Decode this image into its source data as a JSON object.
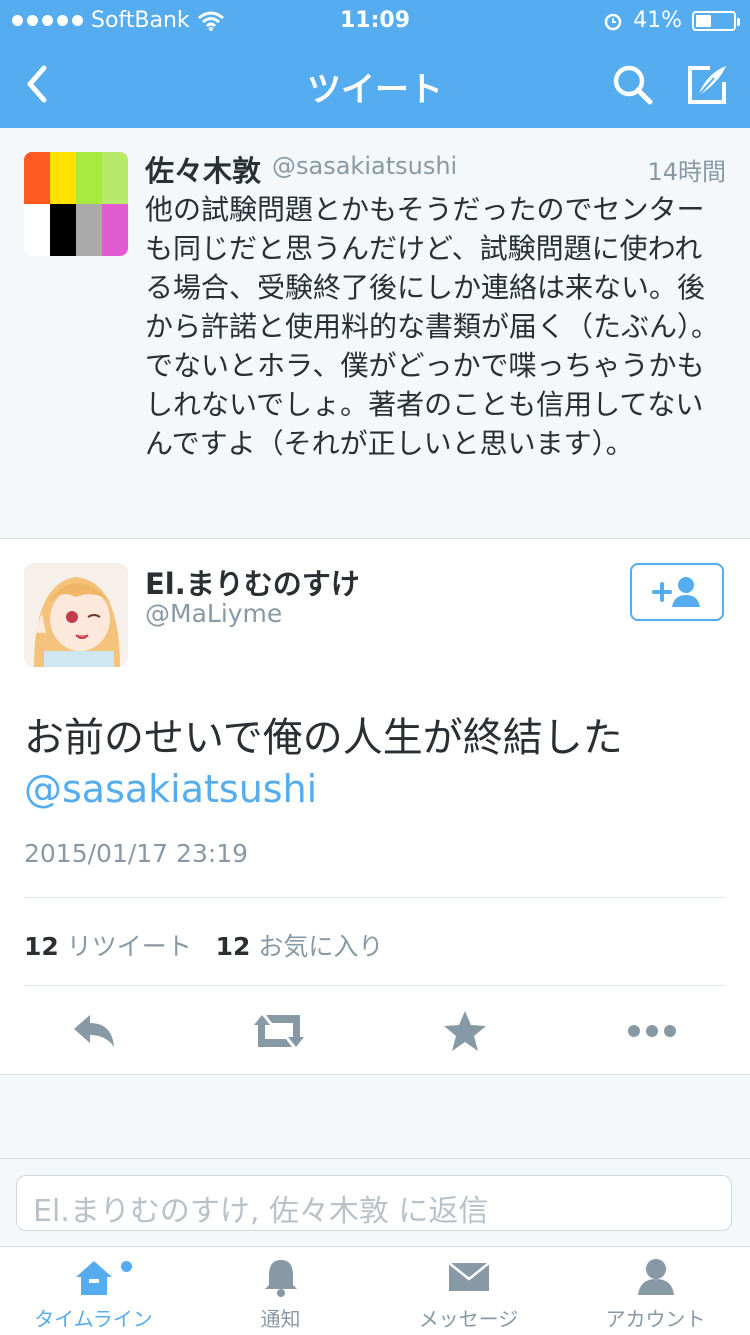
{
  "status": {
    "carrier": "SoftBank",
    "time": "11:09",
    "battery": "41%",
    "battery_level": 0.41
  },
  "nav": {
    "title": "ツイート",
    "back_icon": "chevron-left-icon",
    "search_icon": "search-icon",
    "compose_icon": "compose-icon"
  },
  "parent_tweet": {
    "name": "佐々木敦",
    "handle": "@sasakiatsushi",
    "time": "14時間",
    "text": "他の試験問題とかもそうだったのでセンターも同じだと思うんだけど、試験問題に使われる場合、受験終了後にしか連絡は来ない。後から許諾と使用料的な書類が届く（たぶん）。でないとホラ、僕がどっかで喋っちゃうかもしれないでしょ。著者のことも信用してないんですよ（それが正しいと思います）。",
    "avatar_colors": [
      "#ff5a1f",
      "#ffe100",
      "#a7e93c",
      "#b7e96b",
      "#ffffff",
      "#000000",
      "#aaaaaa",
      "#e05ad0"
    ]
  },
  "tweet": {
    "name": "El.まりむのすけ",
    "handle": "@MaLiyme",
    "text": "お前のせいで俺の人生が終結した",
    "mention": "@sasakiatsushi",
    "date": "2015/01/17 23:19",
    "retweet_count": "12",
    "retweet_label": "リツイート",
    "favorite_count": "12",
    "favorite_label": "お気に入り"
  },
  "reply": {
    "placeholder": "El.まりむのすけ, 佐々木敦 に返信"
  },
  "tabs": [
    {
      "label": "タイムライン",
      "icon": "home-icon"
    },
    {
      "label": "通知",
      "icon": "bell-icon"
    },
    {
      "label": "メッセージ",
      "icon": "envelope-icon"
    },
    {
      "label": "アカウント",
      "icon": "person-icon"
    }
  ],
  "colors": {
    "accent": "#55acee",
    "text": "#292f33",
    "muted": "#8899a6",
    "icon_gray": "#8899a6"
  }
}
